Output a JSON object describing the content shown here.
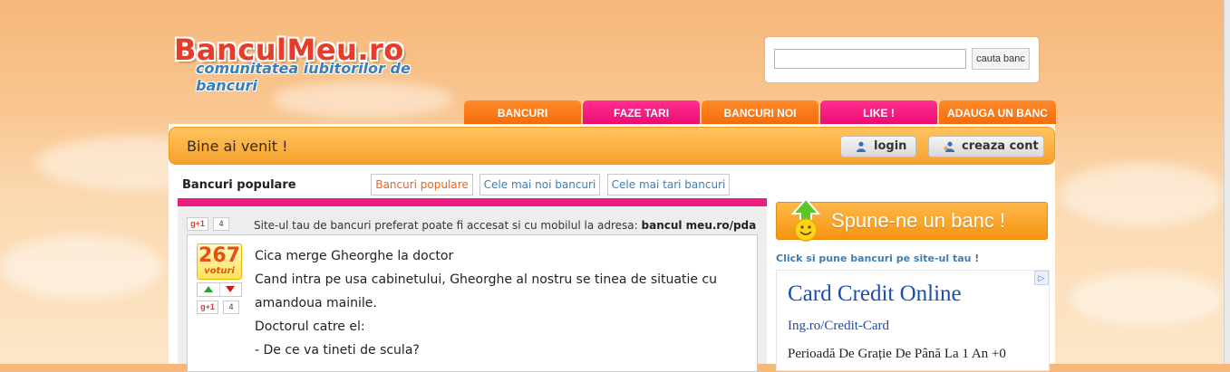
{
  "logo": {
    "name": "BanculMeu.ro",
    "tagline": "comunitatea iubitorilor de bancuri"
  },
  "search": {
    "value": "",
    "placeholder": "",
    "button_label": "cauta banc"
  },
  "nav": {
    "tabs": [
      "BANCURI",
      "FAZE TARI",
      "BANCURI NOI",
      "LIKE !",
      "ADAUGA UN BANC"
    ]
  },
  "welcome": {
    "text": "Bine ai venit !",
    "login_label": "login",
    "register_label": "creaza cont"
  },
  "section": {
    "title": "Bancuri populare",
    "tabs": [
      "Bancuri populare",
      "Cele mai noi bancuri",
      "Cele mai tari bancuri"
    ]
  },
  "share": {
    "gplus_label": "g+1",
    "count": "4"
  },
  "mobile_note": {
    "text": "Site-ul tau de bancuri preferat poate fi accesat si cu mobilul la adresa:",
    "url": "bancul meu.ro/pda"
  },
  "joke": {
    "votes": "267",
    "votes_label": "voturi",
    "gplus_label": "g+1",
    "gplus_count": "4",
    "lines": [
      "Cica merge Gheorghe la doctor",
      "Cand intra pe usa cabinetului, Gheorghe al nostru se tinea de situatie cu",
      "amandoua mainile.",
      "Doctorul catre el:",
      "- De ce va tineti de scula?"
    ]
  },
  "sidebar": {
    "cta": "Spune-ne un banc !",
    "link": "Click si pune bancuri pe site-ul tau !",
    "ad": {
      "badge": "▷",
      "title": "Card Credit Online",
      "url": "Ing.ro/Credit-Card",
      "desc": "Perioadă De Grație De Până La 1 An +0"
    }
  },
  "colors": {
    "orange": "#f7891b",
    "pink": "#ee1b81",
    "link_blue": "#3a7fb8",
    "ad_blue": "#1a4fae"
  }
}
